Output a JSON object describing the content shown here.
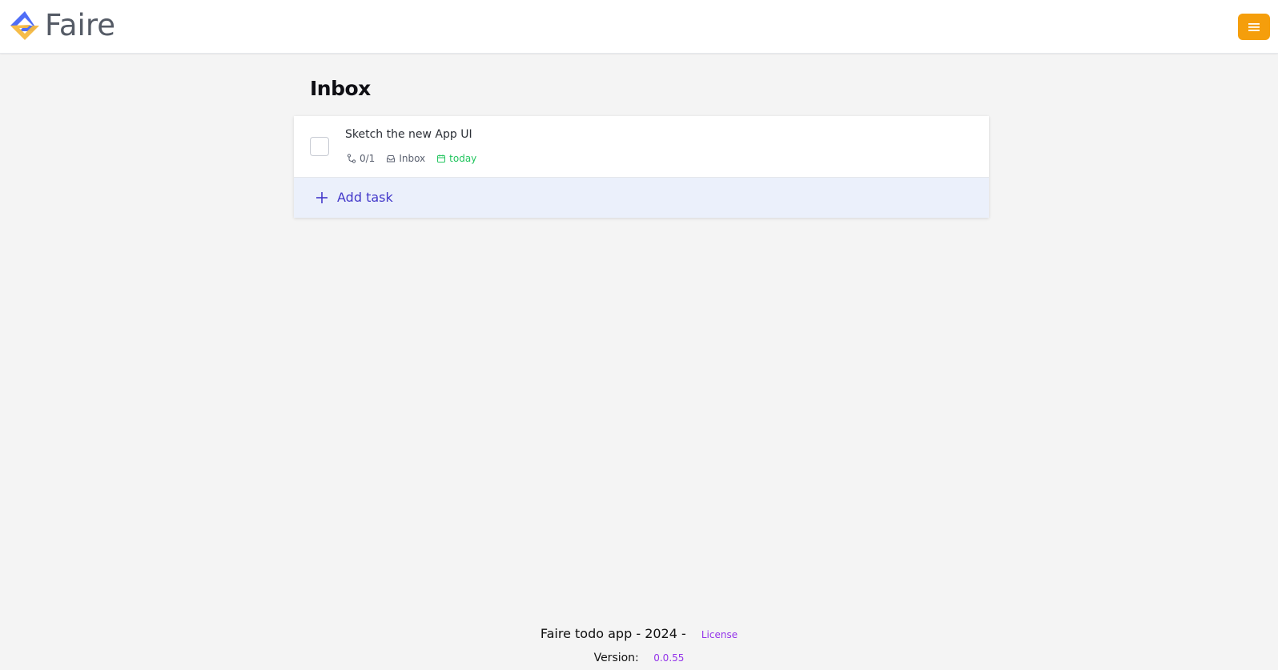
{
  "header": {
    "logo_text": "Faire",
    "brand_colors": {
      "blue": "#4f6ef7",
      "gold": "#f5b940",
      "menu": "#f59e0b"
    },
    "menu_icon": "hamburger-menu-icon"
  },
  "main": {
    "title": "Inbox",
    "tasks": [
      {
        "title": "Sketch the new App UI",
        "subtasks": "0/1",
        "project": "Inbox",
        "due": "today",
        "icons": [
          "subtask-icon",
          "inbox-icon",
          "calendar-icon"
        ]
      }
    ],
    "add_task_label": "Add task"
  },
  "footer": {
    "text": "Faire todo app - 2024 -",
    "license_label": "License",
    "version_label": "Version:",
    "version_value": "0.0.55"
  }
}
